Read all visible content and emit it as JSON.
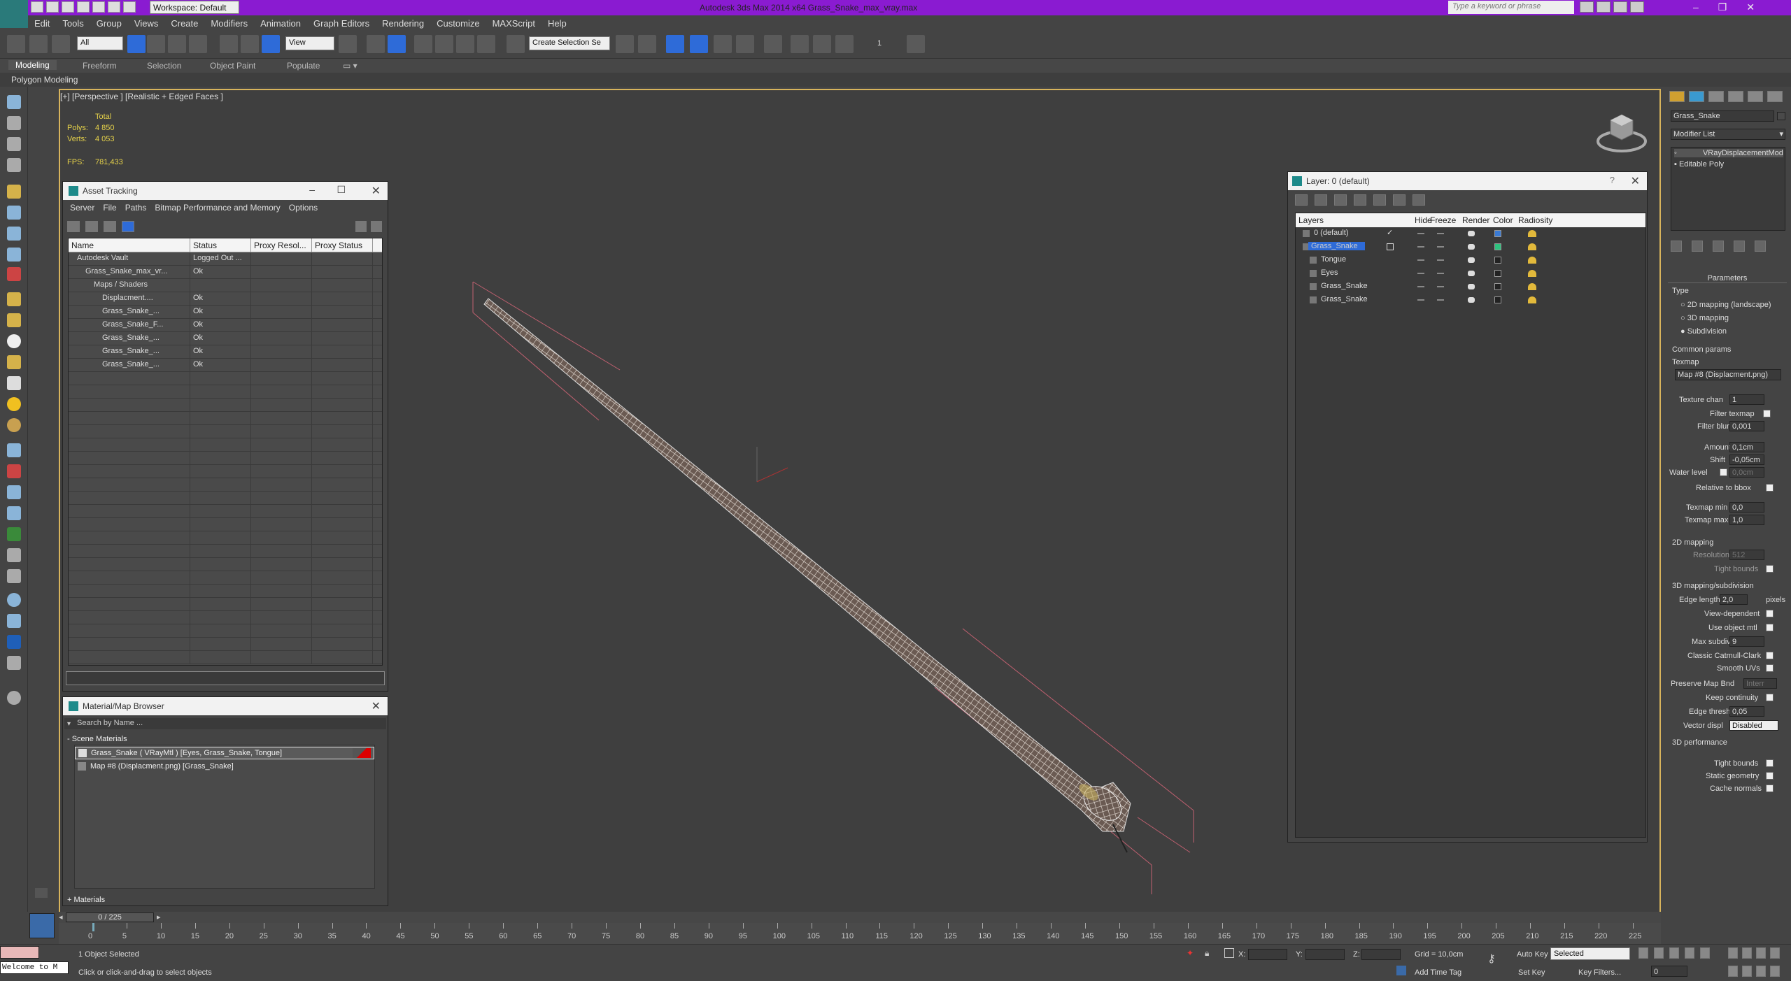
{
  "title": "Autodesk 3ds Max  2014 x64     Grass_Snake_max_vray.max",
  "workspace": "Workspace: Default",
  "search_placeholder": "Type a keyword or phrase",
  "menu": [
    "Edit",
    "Tools",
    "Group",
    "Views",
    "Create",
    "Modifiers",
    "Animation",
    "Graph Editors",
    "Rendering",
    "Customize",
    "MAXScript",
    "Help"
  ],
  "toolbar": {
    "filter": "All",
    "refcoord": "View",
    "named_sel": "Create Selection Se",
    "count": "1"
  },
  "ribbon_tabs": [
    "Modeling",
    "Freeform",
    "Selection",
    "Object Paint",
    "Populate"
  ],
  "ribbon_sub": "Polygon Modeling",
  "viewport": {
    "label": "[+] [Perspective ] [Realistic + Edged Faces ]",
    "total": "Total",
    "polys_label": "Polys:",
    "polys": "4 850",
    "verts_label": "Verts:",
    "verts": "4 053",
    "fps_label": "FPS:",
    "fps": "781,433"
  },
  "asset": {
    "title": "Asset Tracking",
    "menu": [
      "Server",
      "File",
      "Paths",
      "Bitmap Performance and Memory",
      "Options"
    ],
    "columns": [
      "Name",
      "Status",
      "Proxy Resol...",
      "Proxy Status"
    ],
    "rows": [
      {
        "name": "Autodesk Vault",
        "status": "Logged Out ...",
        "indent": 1
      },
      {
        "name": "Grass_Snake_max_vr...",
        "status": "Ok",
        "indent": 2
      },
      {
        "name": "Maps / Shaders",
        "status": "",
        "indent": 3
      },
      {
        "name": "Displacment....",
        "status": "Ok",
        "indent": 4
      },
      {
        "name": "Grass_Snake_...",
        "status": "Ok",
        "indent": 4
      },
      {
        "name": "Grass_Snake_F...",
        "status": "Ok",
        "indent": 4
      },
      {
        "name": "Grass_Snake_...",
        "status": "Ok",
        "indent": 4
      },
      {
        "name": "Grass_Snake_...",
        "status": "Ok",
        "indent": 4
      },
      {
        "name": "Grass_Snake_...",
        "status": "Ok",
        "indent": 4
      }
    ]
  },
  "matbrowser": {
    "title": "Material/Map Browser",
    "search": "Search by Name ...",
    "section": "- Scene Materials",
    "items": [
      "Grass_Snake  ( VRayMtl )  [Eyes, Grass_Snake, Tongue]",
      "Map #8 (Displacment.png)  [Grass_Snake]"
    ],
    "footer": "+ Materials"
  },
  "layer": {
    "title": "Layer: 0 (default)",
    "columns": [
      "Layers",
      "Hide",
      "Freeze",
      "Render",
      "Color",
      "Radiosity"
    ],
    "rows": [
      {
        "name": "0 (default)",
        "color": "#3a7bd5"
      },
      {
        "name": "Grass_Snake",
        "color": "#2ec27e"
      },
      {
        "name": "Tongue",
        "color": "#222222"
      },
      {
        "name": "Eyes",
        "color": "#222222"
      },
      {
        "name": "Grass_Snake",
        "color": "#222222"
      },
      {
        "name": "Grass_Snake",
        "color": "#222222"
      }
    ]
  },
  "cmdpanel": {
    "object_name": "Grass_Snake",
    "modifier_list": "Modifier List",
    "stack": [
      "VRayDisplacementMod",
      "Editable Poly"
    ],
    "params_title": "Parameters",
    "type_label": "Type",
    "types": [
      "2D mapping (landscape)",
      "3D mapping",
      "Subdivision"
    ],
    "common_params": "Common params",
    "texmap": "Texmap",
    "texmap_value": "Map #8 (Displacment.png)",
    "texture_chan_label": "Texture chan",
    "texture_chan": "1",
    "filter_texmap": "Filter texmap",
    "filter_blur_label": "Filter blur",
    "filter_blur": "0,001",
    "amount_label": "Amount",
    "amount": "0,1cm",
    "shift_label": "Shift",
    "shift": "-0,05cm",
    "water_label": "Water level",
    "water": "0,0cm",
    "rel_bbox": "Relative to bbox",
    "texmap_min_label": "Texmap min",
    "texmap_min": "0,0",
    "texmap_max_label": "Texmap max",
    "texmap_max": "1,0",
    "mapping2d": "2D mapping",
    "resolution_label": "Resolution",
    "resolution": "512",
    "tight_bounds": "Tight bounds",
    "mapping3d": "3D mapping/subdivision",
    "edge_length_label": "Edge length",
    "edge_length": "2,0",
    "pixels": "pixels",
    "view_dep": "View-dependent",
    "use_obj_mtl": "Use object mtl",
    "max_subdivs_label": "Max subdivs",
    "max_subdivs": "9",
    "catmull": "Classic Catmull-Clark",
    "smooth_uvs": "Smooth UVs",
    "preserve_label": "Preserve Map Bnd",
    "preserve": "Interr",
    "keep_cont": "Keep continuity",
    "edge_thresh_label": "Edge thresh",
    "edge_thresh": "0,05",
    "vector_label": "Vector displ",
    "vector": "Disabled",
    "perf3d": "3D performance",
    "tight_bounds2": "Tight bounds",
    "static_geo": "Static geometry",
    "cache_normals": "Cache normals"
  },
  "timeline": {
    "frame": "0 / 225",
    "ticks": [
      "0",
      "5",
      "10",
      "15",
      "20",
      "25",
      "30",
      "35",
      "40",
      "45",
      "50",
      "55",
      "60",
      "65",
      "70",
      "75",
      "80",
      "85",
      "90",
      "95",
      "100",
      "105",
      "110",
      "115",
      "120",
      "125",
      "130",
      "135",
      "140",
      "145",
      "150",
      "155",
      "160",
      "165",
      "170",
      "175",
      "180",
      "185",
      "190",
      "195",
      "200",
      "205",
      "210",
      "215",
      "220",
      "225"
    ]
  },
  "status": {
    "welcome": "Welcome to M",
    "selected": "1 Object Selected",
    "prompt": "Click or click-and-drag to select objects",
    "x": "X:",
    "y": "Y:",
    "z": "Z:",
    "grid": "Grid = 10,0cm",
    "addtime": "Add Time Tag",
    "autokey": "Auto Key",
    "setkey": "Set Key",
    "selected_dd": "Selected",
    "keyfilters": "Key Filters...",
    "frame": "0"
  }
}
